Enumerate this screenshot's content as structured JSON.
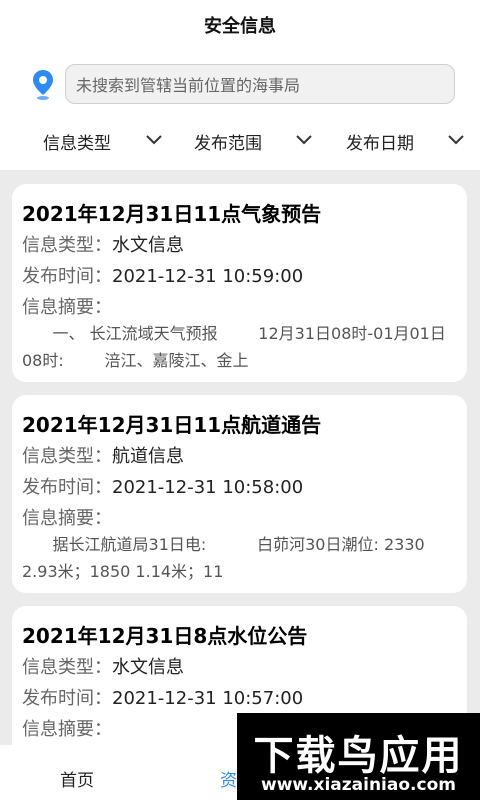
{
  "header": {
    "title": "安全信息",
    "search_placeholder": "未搜索到管辖当前位置的海事局"
  },
  "filters": [
    {
      "label": "信息类型"
    },
    {
      "label": "发布范围"
    },
    {
      "label": "发布日期"
    }
  ],
  "labels": {
    "type": "信息类型：",
    "time": "发布时间：",
    "summary": "信息摘要："
  },
  "cards": [
    {
      "title": "2021年12月31日11点气象预告",
      "type": "水文信息",
      "time": "2021-12-31 10:59:00",
      "summary": "      一、 长江流域天气预报        12月31日08时-01月01日08时:        涪江、嘉陵江、金上"
    },
    {
      "title": "2021年12月31日11点航道通告",
      "type": "航道信息",
      "time": "2021-12-31 10:58:00",
      "summary": "      据长江航道局31日电:          白茆河30日潮位: 2330 2.93米；1850 1.14米；11"
    },
    {
      "title": "2021年12月31日8点水位公告",
      "type": "水文信息",
      "time": "2021-12-31 10:57:00",
      "summary": ""
    }
  ],
  "tabs": [
    {
      "label": "首页"
    },
    {
      "label": "资"
    }
  ],
  "watermark": {
    "big": "下载鸟应用",
    "small": "www.xiazainiao.com"
  },
  "colors": {
    "accent": "#2e8bf0",
    "background": "#ebebeb",
    "card": "#ffffff"
  }
}
